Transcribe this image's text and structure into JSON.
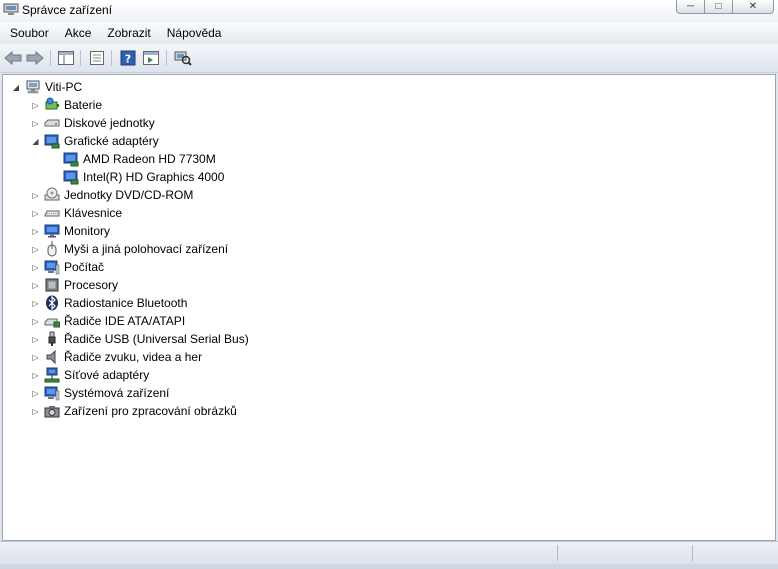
{
  "window": {
    "title": "Správce zařízení",
    "caption_buttons": [
      "minimize-icon",
      "maximize-icon",
      "close-icon"
    ]
  },
  "menu": [
    "Soubor",
    "Akce",
    "Zobrazit",
    "Nápověda"
  ],
  "toolbar": {
    "buttons": [
      "back-arrow-icon",
      "forward-arrow-icon",
      "show-hide-tree-icon",
      "properties-icon",
      "help-icon",
      "action-pane-icon",
      "scan-hardware-icon"
    ]
  },
  "tree": {
    "root": "Viti-PC",
    "categories": [
      {
        "label": "Baterie",
        "icon": "battery-icon",
        "expanded": false
      },
      {
        "label": "Diskové jednotky",
        "icon": "disk-drive-icon",
        "expanded": false
      },
      {
        "label": "Grafické adaptéry",
        "icon": "display-adapter-icon",
        "expanded": true,
        "children": [
          "AMD Radeon HD 7730M",
          "Intel(R) HD Graphics 4000"
        ]
      },
      {
        "label": "Jednotky DVD/CD-ROM",
        "icon": "dvd-drive-icon",
        "expanded": false
      },
      {
        "label": "Klávesnice",
        "icon": "keyboard-icon",
        "expanded": false
      },
      {
        "label": "Monitory",
        "icon": "monitor-icon",
        "expanded": false
      },
      {
        "label": "Myši a jiná polohovací zařízení",
        "icon": "mouse-icon",
        "expanded": false
      },
      {
        "label": "Počítač",
        "icon": "computer-icon",
        "expanded": false
      },
      {
        "label": "Procesory",
        "icon": "processor-icon",
        "expanded": false
      },
      {
        "label": "Radiostanice Bluetooth",
        "icon": "bluetooth-icon",
        "expanded": false
      },
      {
        "label": "Řadiče IDE ATA/ATAPI",
        "icon": "ide-controller-icon",
        "expanded": false
      },
      {
        "label": "Řadiče USB (Universal Serial Bus)",
        "icon": "usb-icon",
        "expanded": false
      },
      {
        "label": "Řadiče zvuku, videa a her",
        "icon": "speaker-icon",
        "expanded": false
      },
      {
        "label": "Síťové adaptéry",
        "icon": "network-adapter-icon",
        "expanded": false
      },
      {
        "label": "Systémová zařízení",
        "icon": "system-device-icon",
        "expanded": false
      },
      {
        "label": "Zařízení pro zpracování obrázků",
        "icon": "camera-icon",
        "expanded": false
      }
    ]
  },
  "colors": {
    "chrome_bg": "#dfe6ee",
    "tree_bg": "#ffffff",
    "tree_border": "#9aa6b4"
  }
}
